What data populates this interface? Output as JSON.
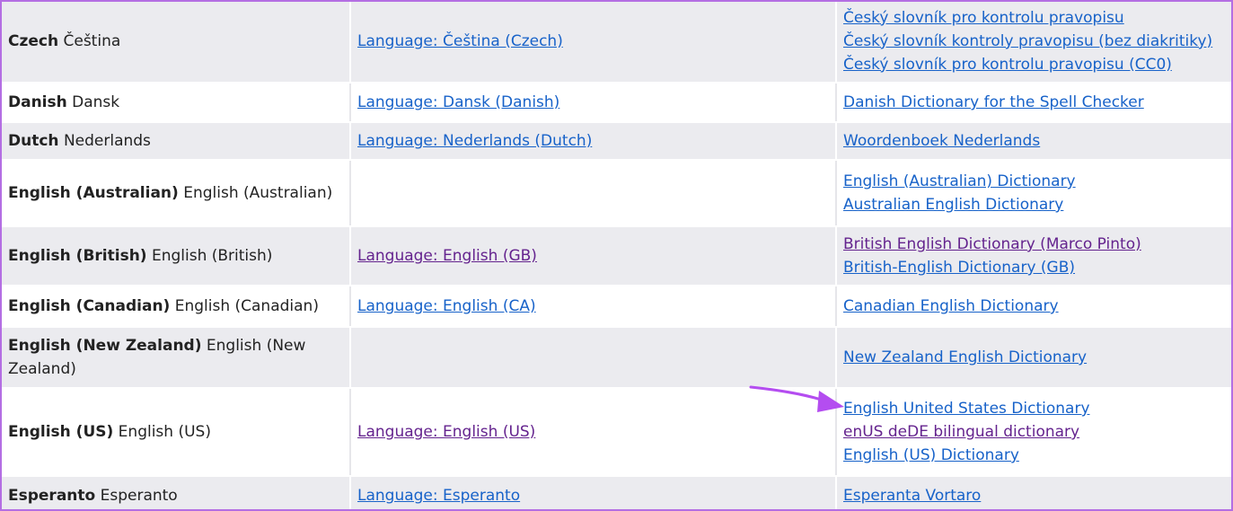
{
  "rows": [
    {
      "lang_bold": "Czech",
      "lang_native": "Čeština",
      "lang_link": {
        "text": "Language: Čeština (Czech)",
        "visited": false
      },
      "dicts": [
        {
          "text": "Český slovník pro kontrolu pravopisu",
          "visited": false
        },
        {
          "text": "Český slovník kontroly pravopisu (bez diakritiky)",
          "visited": false
        },
        {
          "text": "Český slovník pro kontrolu pravopisu (CC0)",
          "visited": false
        }
      ]
    },
    {
      "lang_bold": "Danish",
      "lang_native": "Dansk",
      "lang_link": {
        "text": "Language: Dansk (Danish)",
        "visited": false
      },
      "dicts": [
        {
          "text": "Danish Dictionary for the Spell Checker",
          "visited": false
        }
      ]
    },
    {
      "lang_bold": "Dutch",
      "lang_native": "Nederlands",
      "lang_link": {
        "text": "Language: Nederlands (Dutch)",
        "visited": false
      },
      "dicts": [
        {
          "text": "Woordenboek Nederlands",
          "visited": false
        }
      ]
    },
    {
      "lang_bold": "English (Australian)",
      "lang_native": "English (Australian)",
      "lang_link": null,
      "dicts": [
        {
          "text": "English (Australian) Dictionary",
          "visited": false
        },
        {
          "text": "Australian English Dictionary",
          "visited": false
        }
      ]
    },
    {
      "lang_bold": "English (British)",
      "lang_native": "English (British)",
      "lang_link": {
        "text": "Language: English (GB)",
        "visited": true
      },
      "dicts": [
        {
          "text": "British English Dictionary (Marco Pinto)",
          "visited": true
        },
        {
          "text": "British-English Dictionary (GB)",
          "visited": false
        }
      ]
    },
    {
      "lang_bold": "English (Canadian)",
      "lang_native": "English (Canadian)",
      "lang_link": {
        "text": "Language: English (CA)",
        "visited": false
      },
      "dicts": [
        {
          "text": "Canadian English Dictionary",
          "visited": false
        }
      ]
    },
    {
      "lang_bold": "English (New Zealand)",
      "lang_native": "English (New Zealand)",
      "lang_link": null,
      "dicts": [
        {
          "text": "New Zealand English Dictionary",
          "visited": false
        }
      ]
    },
    {
      "lang_bold": "English (US)",
      "lang_native": "English (US)",
      "lang_link": {
        "text": "Language: English (US)",
        "visited": true
      },
      "dicts": [
        {
          "text": "English United States Dictionary",
          "visited": false
        },
        {
          "text": "enUS deDE bilingual dictionary",
          "visited": true
        },
        {
          "text": "English (US) Dictionary",
          "visited": false
        }
      ]
    },
    {
      "lang_bold": "Esperanto",
      "lang_native": "Esperanto",
      "lang_link": {
        "text": "Language: Esperanto",
        "visited": false
      },
      "dicts": [
        {
          "text": "Esperanta Vortaro",
          "visited": false
        }
      ]
    }
  ],
  "colors": {
    "border": "#b46ee3",
    "stripe": "#ebebef",
    "link": "#1762c9",
    "visited": "#64238e",
    "arrow": "#b44df0"
  },
  "annotation": {
    "icon": "arrow-pointer-icon"
  }
}
